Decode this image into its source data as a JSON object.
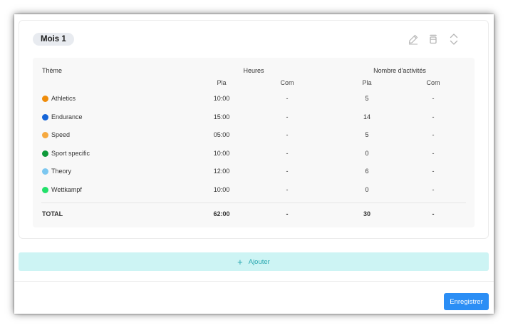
{
  "period": {
    "label": "Mois 1"
  },
  "table": {
    "headers": {
      "theme": "Thème",
      "hours": "Heures",
      "activities": "Nombre d'activités"
    },
    "subheaders": {
      "planned": "Pla",
      "completed": "Com"
    },
    "rows": [
      {
        "name": "Athletics",
        "color": "#ef8c0a",
        "hours_planned": "10:00",
        "hours_completed": "-",
        "act_planned": "5",
        "act_completed": "-"
      },
      {
        "name": "Endurance",
        "color": "#1565d8",
        "hours_planned": "15:00",
        "hours_completed": "-",
        "act_planned": "14",
        "act_completed": "-"
      },
      {
        "name": "Speed",
        "color": "#f6a940",
        "hours_planned": "05:00",
        "hours_completed": "-",
        "act_planned": "5",
        "act_completed": "-"
      },
      {
        "name": "Sport specific",
        "color": "#0e9a3a",
        "hours_planned": "10:00",
        "hours_completed": "-",
        "act_planned": "0",
        "act_completed": "-"
      },
      {
        "name": "Theory",
        "color": "#7cc7f0",
        "hours_planned": "12:00",
        "hours_completed": "-",
        "act_planned": "6",
        "act_completed": "-"
      },
      {
        "name": "Wettkampf",
        "color": "#22e06a",
        "hours_planned": "10:00",
        "hours_completed": "-",
        "act_planned": "0",
        "act_completed": "-"
      }
    ],
    "total": {
      "label": "TOTAL",
      "hours_planned": "62:00",
      "hours_completed": "-",
      "act_planned": "30",
      "act_completed": "-"
    }
  },
  "actions": {
    "add_label": "Ajouter",
    "save_label": "Enregistrer"
  },
  "icons": {
    "edit": "pencil-icon",
    "delete": "trash-icon",
    "collapse": "chevron-up-down-icon"
  },
  "colors": {
    "accent": "#2b8ef5",
    "add_bg": "#cdf4f4",
    "add_text": "#2aa8b0"
  }
}
